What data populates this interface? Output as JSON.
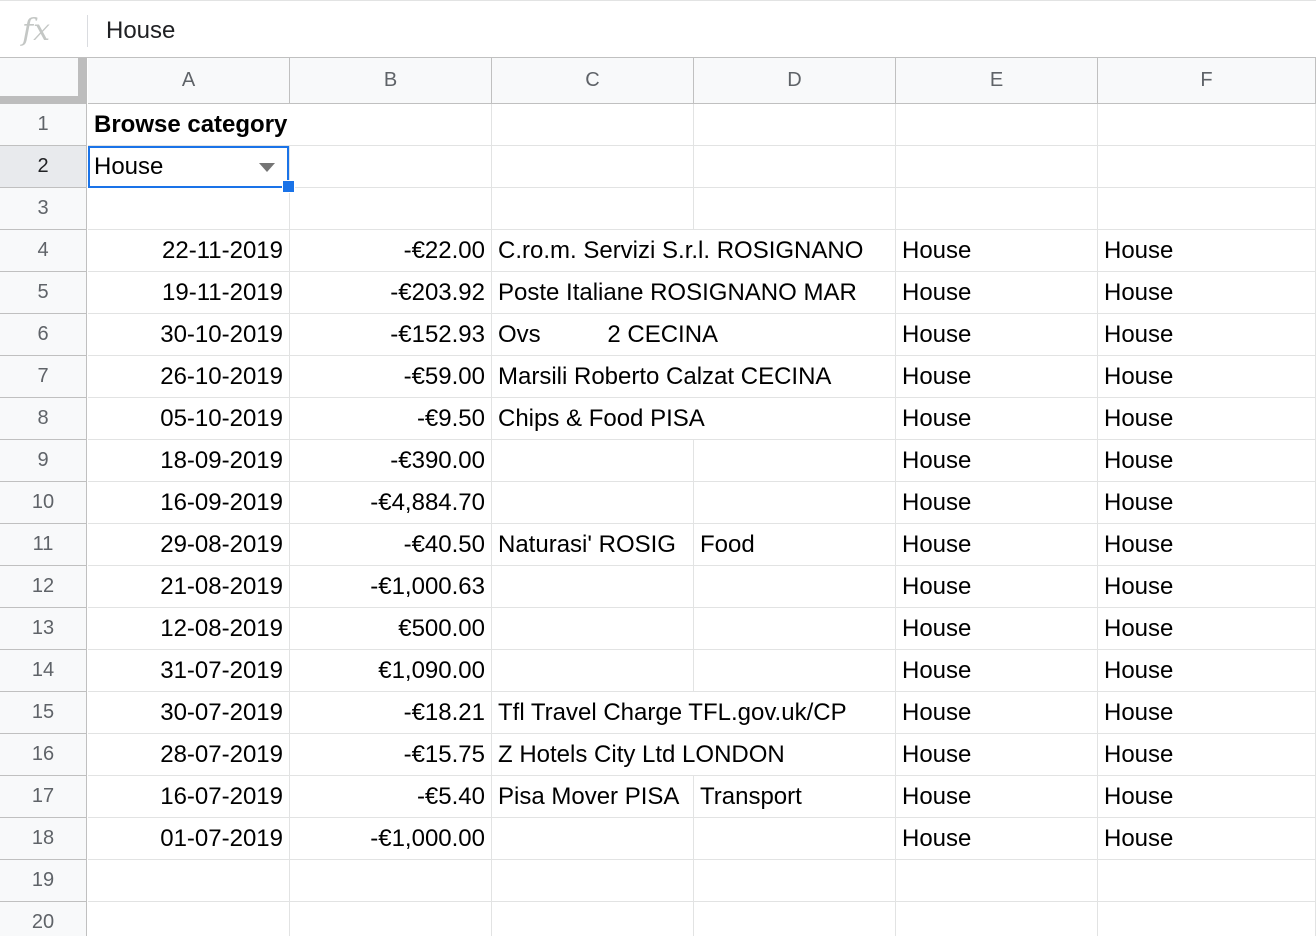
{
  "formula_bar": {
    "icon": "fx",
    "value": "House"
  },
  "columns": [
    "A",
    "B",
    "C",
    "D",
    "E",
    "F"
  ],
  "rows": [
    {
      "n": "1",
      "a": "Browse category",
      "b": "",
      "c": "",
      "d": "",
      "e": "",
      "f": ""
    },
    {
      "n": "2",
      "a": "House",
      "b": "",
      "c": "",
      "d": "",
      "e": "",
      "f": ""
    },
    {
      "n": "3",
      "a": "",
      "b": "",
      "c": "",
      "d": "",
      "e": "",
      "f": ""
    },
    {
      "n": "4",
      "a": "22-11-2019",
      "b": "-€22.00",
      "c": "C.ro.m. Servizi S.r.l. ROSIGNANO",
      "d": "",
      "e": "House",
      "f": "House"
    },
    {
      "n": "5",
      "a": "19-11-2019",
      "b": "-€203.92",
      "c": "Poste Italiane ROSIGNANO MAR",
      "d": "",
      "e": "House",
      "f": "House"
    },
    {
      "n": "6",
      "a": "30-10-2019",
      "b": "-€152.93",
      "c": "Ovs          2 CECINA",
      "d": "",
      "e": "House",
      "f": "House"
    },
    {
      "n": "7",
      "a": "26-10-2019",
      "b": "-€59.00",
      "c": "Marsili Roberto Calzat CECINA",
      "d": "",
      "e": "House",
      "f": "House"
    },
    {
      "n": "8",
      "a": "05-10-2019",
      "b": "-€9.50",
      "c": "Chips & Food PISA",
      "d": "",
      "e": "House",
      "f": "House"
    },
    {
      "n": "9",
      "a": "18-09-2019",
      "b": "-€390.00",
      "c": "",
      "d": "",
      "e": "House",
      "f": "House"
    },
    {
      "n": "10",
      "a": "16-09-2019",
      "b": "-€4,884.70",
      "c": "",
      "d": "",
      "e": "House",
      "f": "House"
    },
    {
      "n": "11",
      "a": "29-08-2019",
      "b": "-€40.50",
      "c": "Naturasi' ROSIG",
      "d": "Food",
      "e": "House",
      "f": "House"
    },
    {
      "n": "12",
      "a": "21-08-2019",
      "b": "-€1,000.63",
      "c": "",
      "d": "",
      "e": "House",
      "f": "House"
    },
    {
      "n": "13",
      "a": "12-08-2019",
      "b": "€500.00",
      "c": "",
      "d": "",
      "e": "House",
      "f": "House"
    },
    {
      "n": "14",
      "a": "31-07-2019",
      "b": "€1,090.00",
      "c": "",
      "d": "",
      "e": "House",
      "f": "House"
    },
    {
      "n": "15",
      "a": "30-07-2019",
      "b": "-€18.21",
      "c": "Tfl Travel Charge TFL.gov.uk/CP",
      "d": "",
      "e": "House",
      "f": "House"
    },
    {
      "n": "16",
      "a": "28-07-2019",
      "b": "-€15.75",
      "c": "Z Hotels City Ltd LONDON",
      "d": "",
      "e": "House",
      "f": "House"
    },
    {
      "n": "17",
      "a": "16-07-2019",
      "b": "-€5.40",
      "c": "Pisa Mover PISA",
      "d": "Transport",
      "e": "House",
      "f": "House"
    },
    {
      "n": "18",
      "a": "01-07-2019",
      "b": "-€1,000.00",
      "c": "",
      "d": "",
      "e": "House",
      "f": "House"
    },
    {
      "n": "19",
      "a": "",
      "b": "",
      "c": "",
      "d": "",
      "e": "",
      "f": ""
    },
    {
      "n": "20",
      "a": "",
      "b": "",
      "c": "",
      "d": "",
      "e": "",
      "f": ""
    }
  ],
  "selected_cell": "A2",
  "colors": {
    "selection": "#1a73e8",
    "header_bg": "#f8f9fa",
    "gridline": "#e2e3e3"
  }
}
